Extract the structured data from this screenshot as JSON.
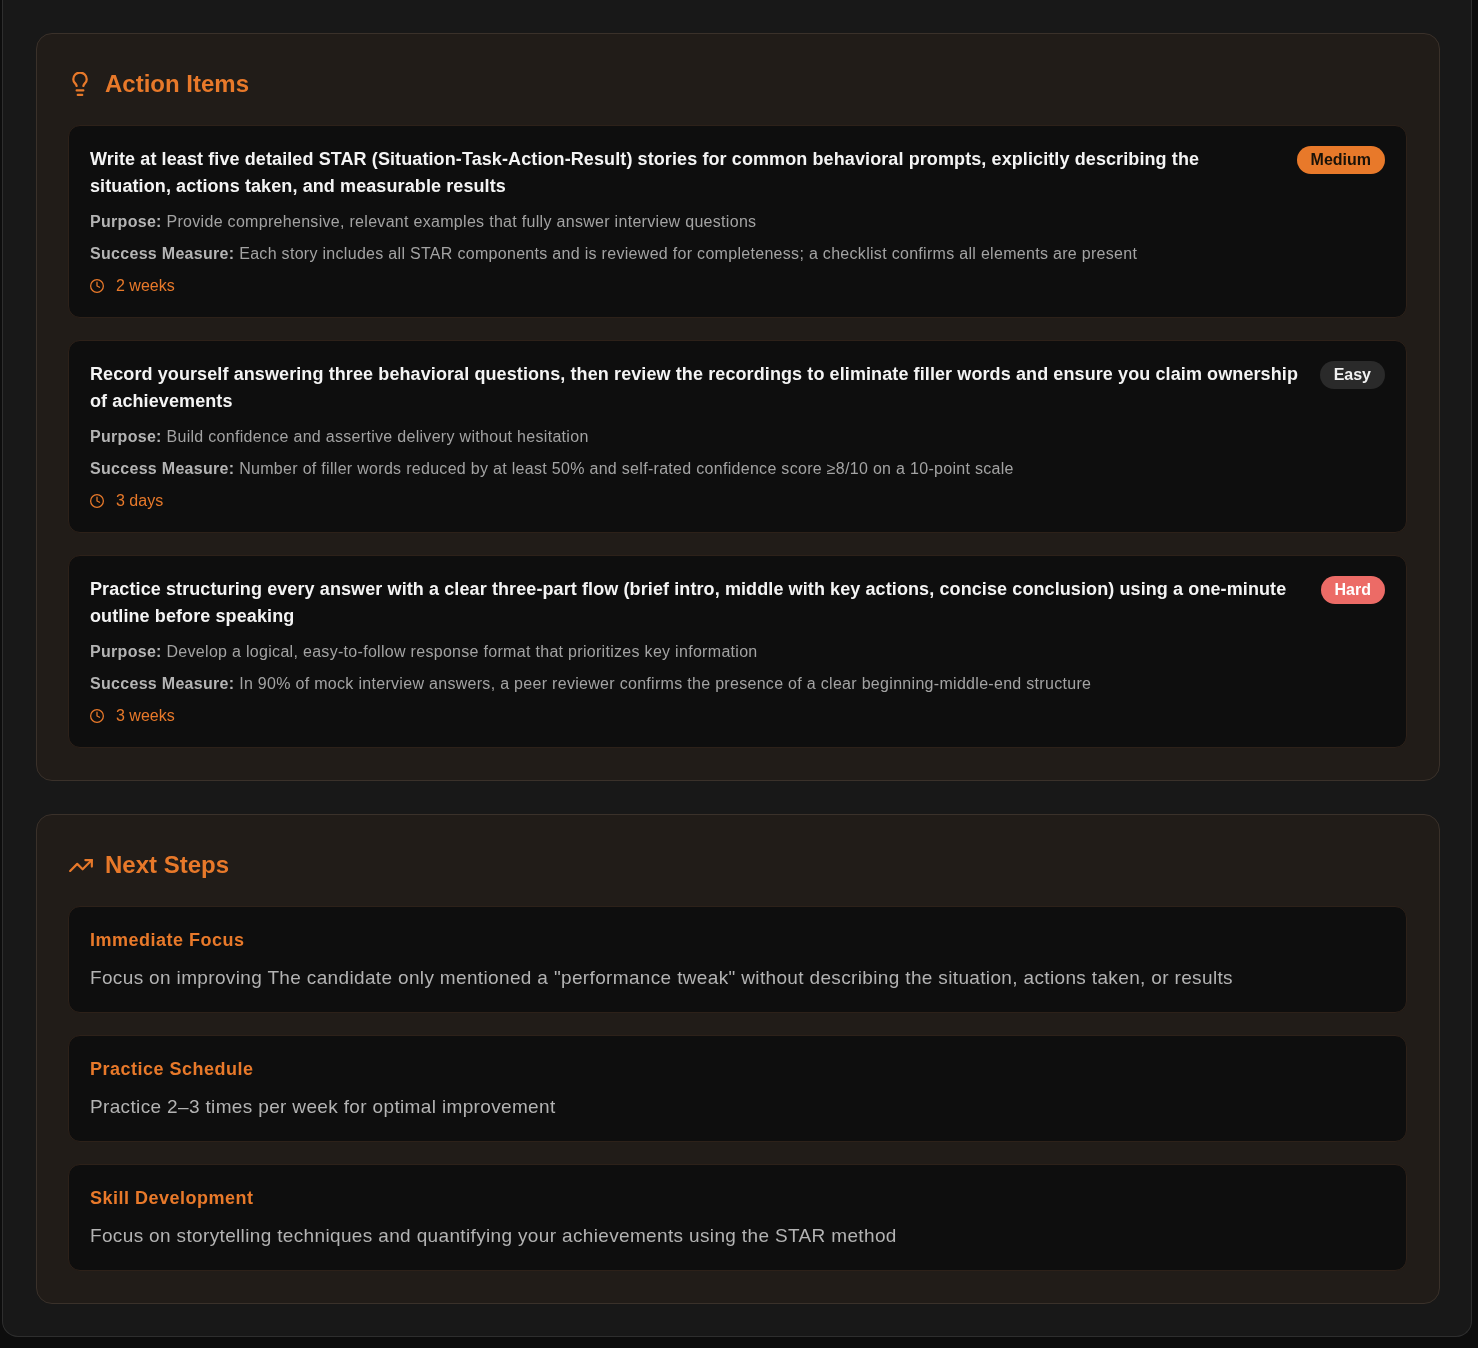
{
  "action_items": {
    "title": "Action Items",
    "items": [
      {
        "title": "Write at least five detailed STAR (Situation-Task-Action-Result) stories for common behavioral prompts, explicitly describing the situation, actions taken, and measurable results",
        "badge": {
          "label": "Medium",
          "kind": "accent",
          "color": "#e8792a"
        },
        "purpose": "**Purpose:** Provide comprehensive, relevant examples that fully answer interview questions",
        "success_measure": "**Success Measure:** Each story includes all STAR components and is reviewed for completeness; a checklist confirms all elements are present",
        "duration": "2 weeks"
      },
      {
        "title": "Record yourself answering three behavioral questions, then review the recordings to eliminate filler words and ensure you claim ownership of achievements",
        "badge": {
          "label": "Easy",
          "kind": "neutral",
          "color": "#2a2a2a"
        },
        "purpose": "**Purpose:** Build confidence and assertive delivery without hesitation",
        "success_measure": "**Success Measure:** Number of filler words reduced by at least 50% and self-rated confidence score ≥8/10 on a 10‑point scale",
        "duration": "3 days"
      },
      {
        "title": "Practice structuring every answer with a clear three‑part flow (brief intro, middle with key actions, concise conclusion) using a one‑minute outline before speaking",
        "badge": {
          "label": "Hard",
          "kind": "alert",
          "color": "#ec6b66"
        },
        "purpose": "**Purpose:** Develop a logical, easy-to-follow response format that prioritizes key information",
        "success_measure": "**Success Measure:** In 90% of mock interview answers, a peer reviewer confirms the presence of a clear beginning-middle-end structure",
        "duration": "3 weeks"
      }
    ]
  },
  "next_steps": {
    "title": "Next Steps",
    "items": [
      {
        "title": "Immediate Focus",
        "text": "Focus on improving The candidate only mentioned a \"performance tweak\" without describing the situation, actions taken, or results"
      },
      {
        "title": "Practice Schedule",
        "text": "Practice 2–3 times per week for optimal improvement"
      },
      {
        "title": "Skill Development",
        "text": "Focus on storytelling techniques and quantifying your achievements using the STAR method"
      }
    ]
  }
}
